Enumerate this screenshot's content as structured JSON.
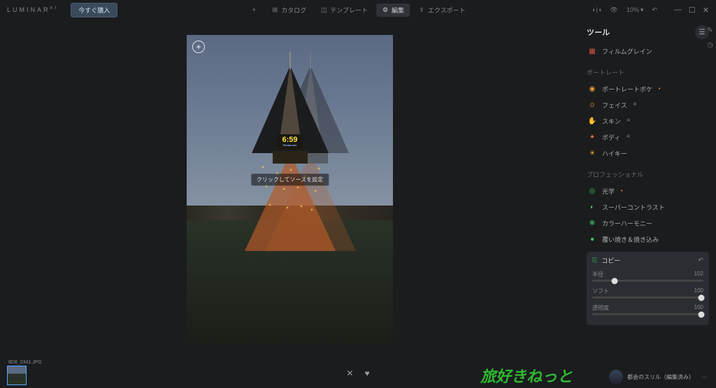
{
  "app": {
    "name": "LUMINAR",
    "suffix": "AI"
  },
  "header": {
    "buy": "今すぐ購入",
    "tabs": {
      "add": "+",
      "catalog": "カタログ",
      "template": "テンプレート",
      "edit": "編集",
      "export": "エクスポート"
    },
    "zoom": "10%"
  },
  "canvas": {
    "overlay_hint": "クリックしてソースを設定",
    "clock": "6:59",
    "clock_sub": "Panasonic"
  },
  "sidebar": {
    "title": "ツール",
    "tools": {
      "film_grain": "フィルムグレイン"
    },
    "section_portrait": "ポートレート",
    "portrait": {
      "bokeh": "ポートレートボケ",
      "face": "フェイス",
      "skin": "スキン",
      "body": "ボディ",
      "hikey": "ハイキー"
    },
    "section_pro": "プロフェッショナル",
    "pro": {
      "optics": "光学",
      "supercontrast": "スーパーコントラスト",
      "colorharmony": "カラーハーモニー",
      "dodgeburn": "覆い焼き＆焼き込み"
    },
    "active": {
      "name": "コピー",
      "sliders": {
        "radius_label": "半径",
        "radius_val": "102",
        "soft_label": "ソフト",
        "soft_val": "100",
        "opacity_label": "透明度",
        "opacity_val": "100"
      }
    }
  },
  "bottom": {
    "filename": "8D8_0341.JPG",
    "preset": "都会のスリル（編集済み）"
  },
  "watermark": "旅好きねっと"
}
